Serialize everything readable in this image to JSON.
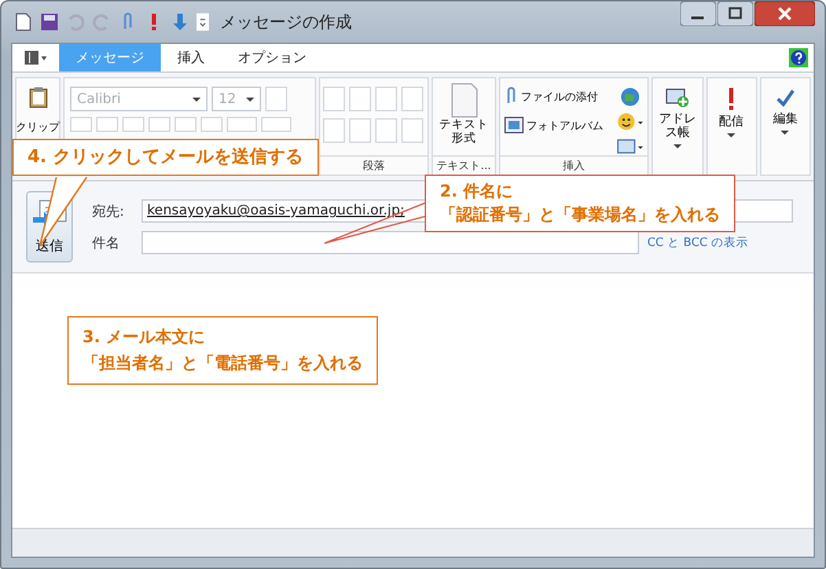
{
  "window": {
    "title": "メッセージの作成"
  },
  "tabs": [
    {
      "label": "メッセージ",
      "selected": true
    },
    {
      "label": "挿入",
      "selected": false
    },
    {
      "label": "オプション",
      "selected": false
    }
  ],
  "ribbon": {
    "clipboard": {
      "label": "クリップ"
    },
    "font": {
      "name": "Calibri",
      "size": "12",
      "disabled": true
    },
    "paragraph": {
      "label": "段落"
    },
    "text_format": {
      "button_lines": [
        "テキスト",
        "形式"
      ],
      "label": "テキスト..."
    },
    "insert": {
      "items": [
        "ファイルの添付",
        "フォトアルバム"
      ],
      "label": "挿入"
    },
    "buttons": [
      {
        "label": "アドレス帳",
        "kind": "address"
      },
      {
        "label": "配信",
        "kind": "priority"
      },
      {
        "label": "編集",
        "kind": "spelling"
      }
    ]
  },
  "header": {
    "send": "送信",
    "to_label": "宛先:",
    "to_value": "kensayoyaku@oasis-yamaguchi.or.jp;",
    "subject_label": "件名",
    "cc_link": "CC と BCC の表示"
  },
  "callouts": [
    {
      "lines": [
        "4. クリックしてメールを送信する"
      ],
      "color": "#e07a20",
      "kind": "send"
    },
    {
      "lines": [
        "2. 件名に",
        "「認証番号」と「事業場名」を入れる"
      ],
      "color": "#e05a4a",
      "kind": "subject"
    },
    {
      "lines": [
        "3. メール本文に",
        "「担当者名」と「電話番号」を入れる"
      ],
      "color": "#e07a20",
      "kind": "body"
    }
  ]
}
